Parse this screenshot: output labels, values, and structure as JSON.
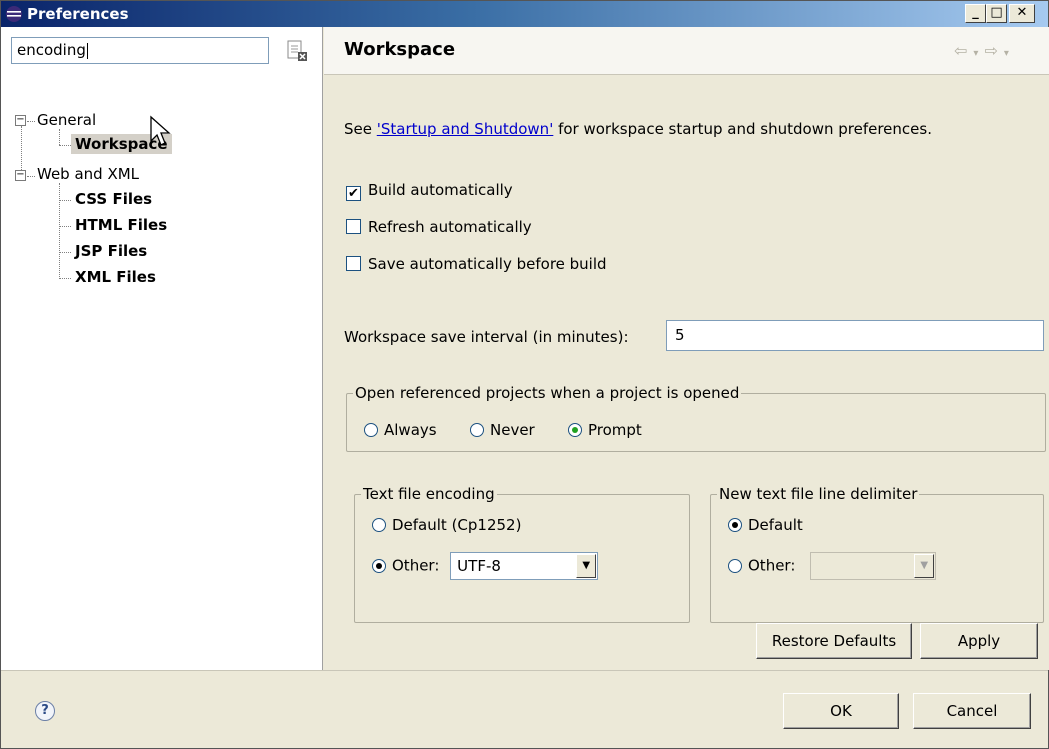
{
  "window": {
    "title": "Preferences"
  },
  "filter": {
    "value": "encoding"
  },
  "tree": {
    "general": "General",
    "workspace": "Workspace",
    "web_and_xml": "Web and XML",
    "css": "CSS Files",
    "html": "HTML Files",
    "jsp": "JSP Files",
    "xml": "XML Files"
  },
  "page": {
    "title": "Workspace",
    "desc_prefix": "See ",
    "desc_link": "'Startup and Shutdown'",
    "desc_suffix": " for workspace startup and shutdown preferences.",
    "build_auto": "Build automatically",
    "build_auto_checked": true,
    "refresh_auto": "Refresh automatically",
    "refresh_auto_checked": false,
    "save_auto": "Save automatically before build",
    "save_auto_checked": false,
    "interval_label": "Workspace save interval (in minutes):",
    "interval_value": "5",
    "open_ref": {
      "legend": "Open referenced projects when a project is opened",
      "always": "Always",
      "never": "Never",
      "prompt": "Prompt",
      "selected": "Prompt"
    },
    "encoding": {
      "legend": "Text file encoding",
      "default": "Default (Cp1252)",
      "other": "Other:",
      "value": "UTF-8",
      "selected": "Other"
    },
    "delimiter": {
      "legend": "New text file line delimiter",
      "default": "Default",
      "other": "Other:",
      "value": "",
      "selected": "Default"
    },
    "restore_defaults": "Restore Defaults",
    "apply": "Apply"
  },
  "footer": {
    "ok": "OK",
    "cancel": "Cancel"
  },
  "colors": {
    "titlebar_start": "#0a246a",
    "titlebar_end": "#a6caf0",
    "link": "#0000cc"
  }
}
